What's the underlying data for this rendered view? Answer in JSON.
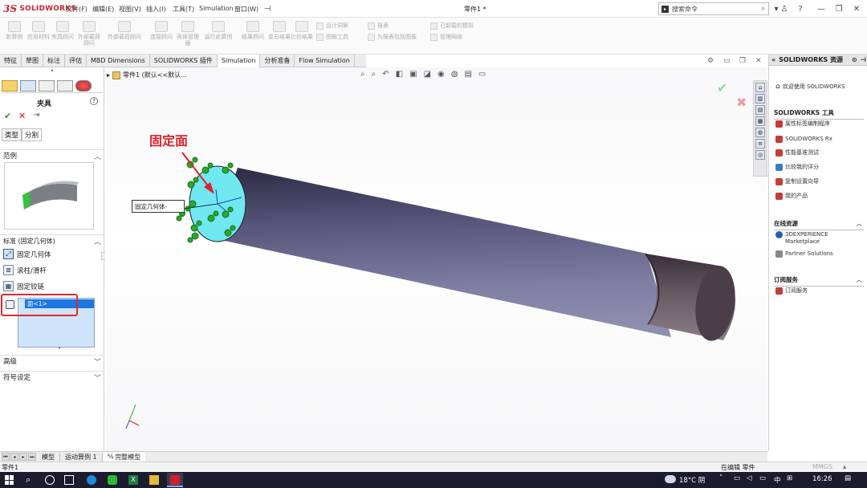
{
  "app": {
    "logo_text": "SOLIDWORKS",
    "logo_glyph": "3S",
    "doc_title": "零件1 *"
  },
  "menu": [
    "文件(F)",
    "编辑(E)",
    "视图(V)",
    "插入(I)",
    "工具(T)",
    "Simulation",
    "窗口(W)"
  ],
  "search": {
    "placeholder": "搜索命令"
  },
  "command_manager": {
    "big": [
      "新算例",
      "应用材料",
      "夹具顾问",
      "外部载荷顾问",
      "连接顾问",
      "壳体管理器",
      "运行此算例",
      "结果顾问",
      "变形结果",
      "比较结果"
    ],
    "small": [
      "设计洞察",
      "图解工具",
      "报表",
      "为报表包括图像",
      "已卸载的模拟",
      "管理网络"
    ]
  },
  "tabs": [
    "特征",
    "草图",
    "标注",
    "评估",
    "MBD Dimensions",
    "SOLIDWORKS 插件",
    "Simulation",
    "分析准备",
    "Flow Simulation"
  ],
  "active_tab": "Simulation",
  "property_manager": {
    "title": "夹具",
    "subtabs": [
      "类型",
      "分割"
    ],
    "example_header": "范例",
    "standard_header": "标准 (固定几何体)",
    "options": [
      "固定几何体",
      "滚柱/滑杆",
      "固定铰链"
    ],
    "selection_item": "面<1>",
    "advanced_header": "高级",
    "symbol_header": "符号设定"
  },
  "viewport": {
    "breadcrumb": "零件1 (默认<<默认...",
    "annotation": "固定面",
    "callout": "固定几何体-",
    "colors": {
      "fixture": "#2aa82a",
      "face": "#6fe8f2",
      "annotation": "#e0202a",
      "highlight": "#e02a2a"
    }
  },
  "right_panel": {
    "title": "SOLIDWORKS 资源",
    "welcome": "欢迎使用 SOLIDWORKS",
    "tools_header": "SOLIDWORKS 工具",
    "tools": [
      "属性标签编制程序",
      "SOLIDWORKS Rx",
      "性能基准测试",
      "比较我的评分",
      "复制设置向导",
      "我的产品"
    ],
    "online_header": "在线资源",
    "online": [
      "3DEXPERIENCE Marketplace",
      "Partner Solutions"
    ],
    "subscription_header": "订阅服务",
    "subscription": [
      "订阅服务"
    ]
  },
  "bottom_tabs": [
    "模型",
    "运动算例 1",
    "完整模型"
  ],
  "status": {
    "left": "零件1",
    "mode": "在编辑 零件",
    "units": "MMGS"
  },
  "taskbar": {
    "weather": "18°C 阴",
    "lang": "中",
    "time": "16:26"
  }
}
